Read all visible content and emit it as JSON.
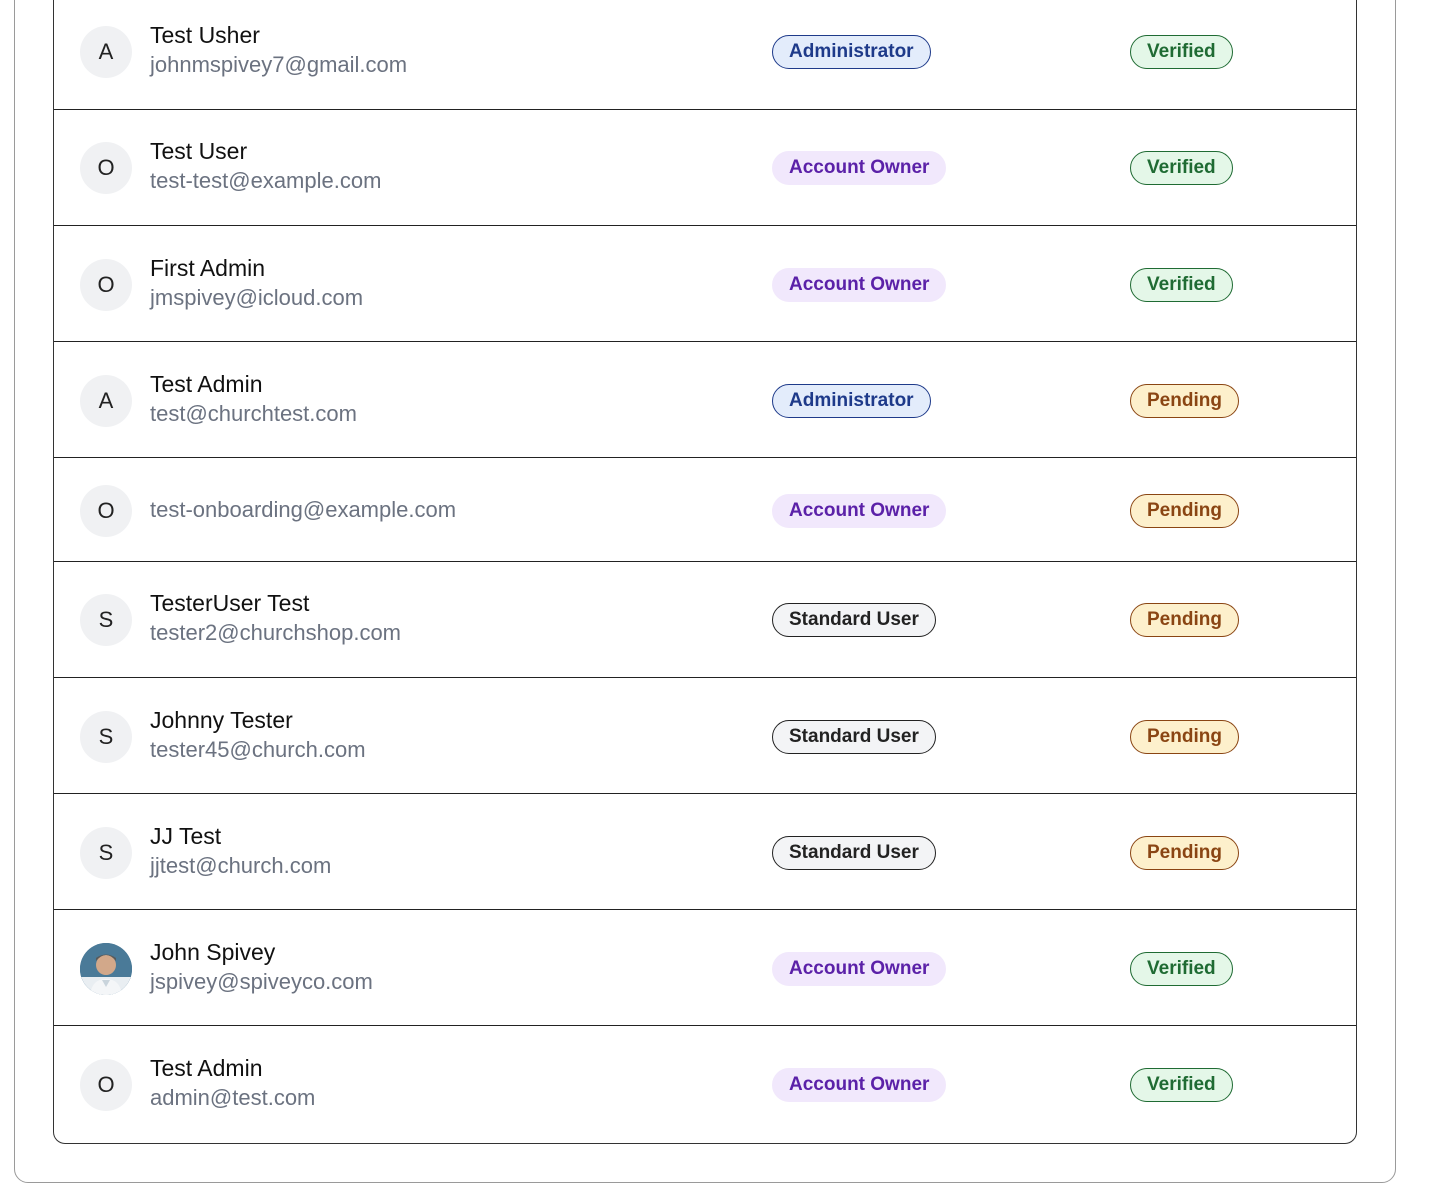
{
  "members": [
    {
      "initial": "A",
      "name": "Test Usher",
      "email": "johnmspivey7@gmail.com",
      "role": "Administrator",
      "role_type": "admin",
      "status": "Verified",
      "status_type": "verified",
      "avatar": "initial"
    },
    {
      "initial": "O",
      "name": "Test User",
      "email": "test-test@example.com",
      "role": "Account Owner",
      "role_type": "owner",
      "status": "Verified",
      "status_type": "verified",
      "avatar": "initial"
    },
    {
      "initial": "O",
      "name": "First Admin",
      "email": "jmspivey@icloud.com",
      "role": "Account Owner",
      "role_type": "owner",
      "status": "Verified",
      "status_type": "verified",
      "avatar": "initial"
    },
    {
      "initial": "A",
      "name": "Test Admin",
      "email": "test@churchtest.com",
      "role": "Administrator",
      "role_type": "admin",
      "status": "Pending",
      "status_type": "pending",
      "avatar": "initial"
    },
    {
      "initial": "O",
      "name": "",
      "email": "test-onboarding@example.com",
      "role": "Account Owner",
      "role_type": "owner",
      "status": "Pending",
      "status_type": "pending",
      "avatar": "initial"
    },
    {
      "initial": "S",
      "name": "TesterUser Test",
      "email": "tester2@churchshop.com",
      "role": "Standard User",
      "role_type": "standard",
      "status": "Pending",
      "status_type": "pending",
      "avatar": "initial"
    },
    {
      "initial": "S",
      "name": "Johnny Tester",
      "email": "tester45@church.com",
      "role": "Standard User",
      "role_type": "standard",
      "status": "Pending",
      "status_type": "pending",
      "avatar": "initial"
    },
    {
      "initial": "S",
      "name": "JJ Test",
      "email": "jjtest@church.com",
      "role": "Standard User",
      "role_type": "standard",
      "status": "Pending",
      "status_type": "pending",
      "avatar": "initial"
    },
    {
      "initial": "",
      "name": "John Spivey",
      "email": "jspivey@spiveyco.com",
      "role": "Account Owner",
      "role_type": "owner",
      "status": "Verified",
      "status_type": "verified",
      "avatar": "photo"
    },
    {
      "initial": "O",
      "name": "Test Admin",
      "email": "admin@test.com",
      "role": "Account Owner",
      "role_type": "owner",
      "status": "Verified",
      "status_type": "verified",
      "avatar": "initial"
    }
  ],
  "colors": {
    "admin_badge_bg": "#e3ecfb",
    "owner_badge_bg": "#f1e8fc",
    "standard_badge_bg": "#f3f4f6",
    "verified_bg": "#e4f7e8",
    "pending_bg": "#fdf0cc"
  }
}
